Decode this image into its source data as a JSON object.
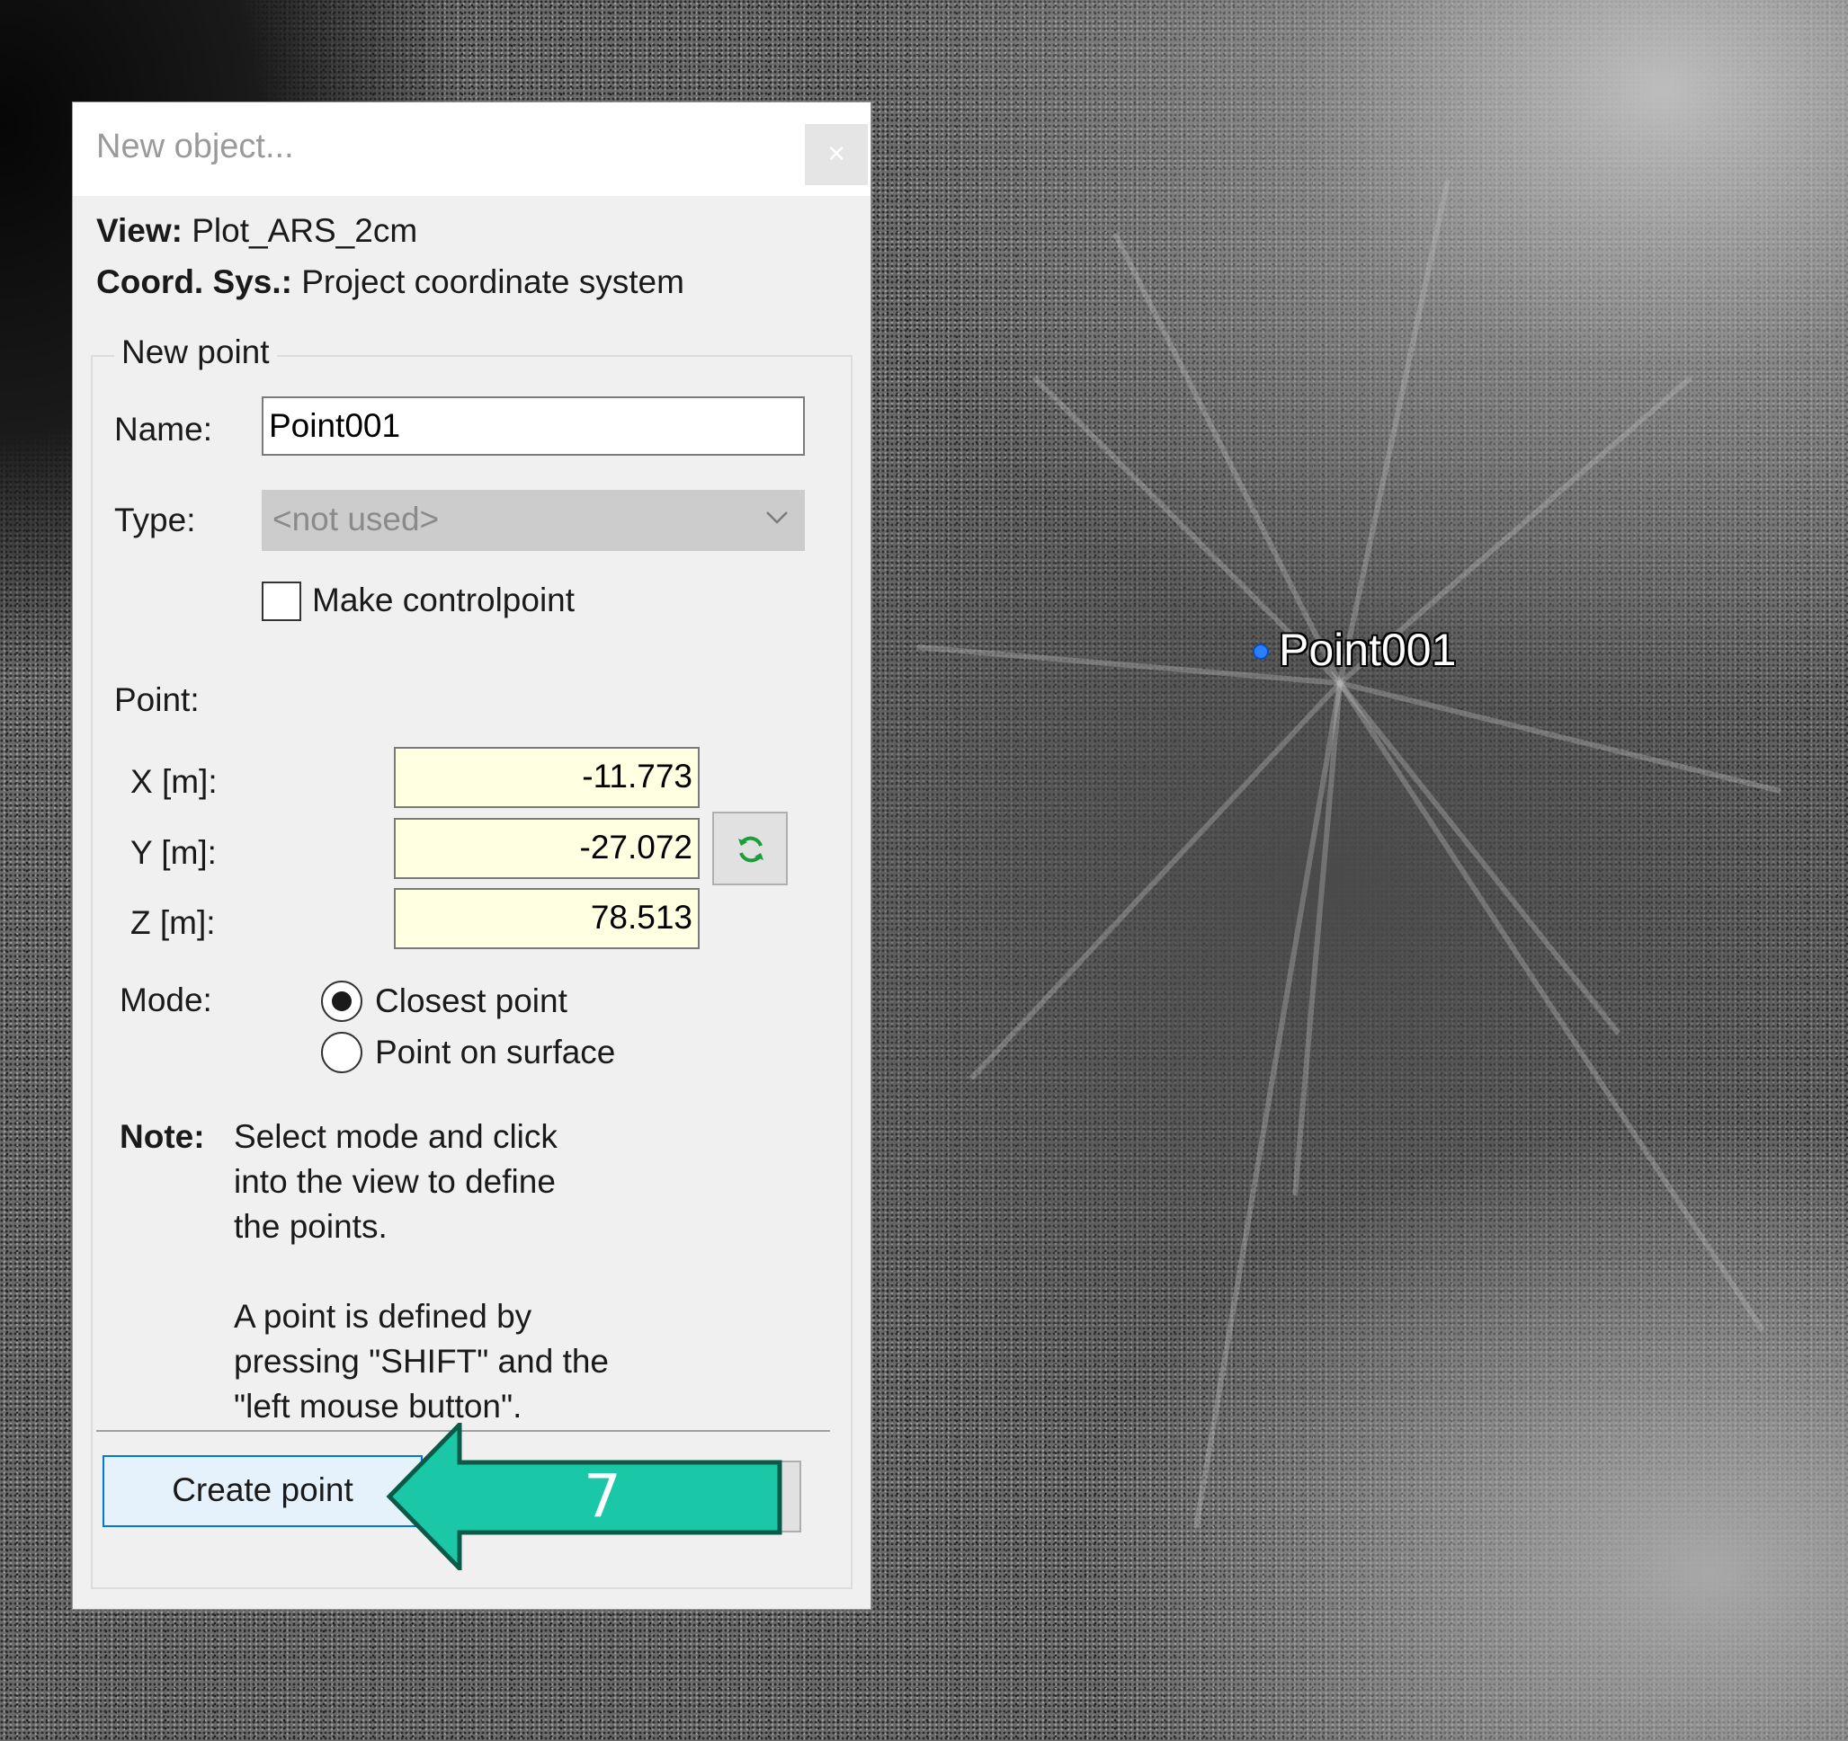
{
  "dialog": {
    "title": "New object...",
    "close_symbol": "×",
    "view_label": "View:",
    "view_value": "Plot_ARS_2cm",
    "coord_label": "Coord. Sys.:",
    "coord_value": "Project coordinate system",
    "group_title": "New point",
    "name_label": "Name:",
    "name_value": "Point001",
    "type_label": "Type:",
    "type_value": "<not used>",
    "make_controlpoint_label": "Make controlpoint",
    "make_controlpoint_checked": false,
    "point_label": "Point:",
    "x_label": "X [m]:",
    "x_value": "-11.773",
    "y_label": "Y [m]:",
    "y_value": "-27.072",
    "z_label": "Z [m]:",
    "z_value": "78.513",
    "refresh_icon": "refresh-icon",
    "mode_label": "Mode:",
    "mode_options": [
      "Closest point",
      "Point on surface"
    ],
    "mode_selected": "Closest point",
    "note_label": "Note:",
    "note_lines": [
      "Select mode and click",
      "into the view to define",
      "the points.",
      "",
      "A point is defined by",
      "pressing \"SHIFT\" and the",
      "\"left mouse button\"."
    ],
    "create_button": "Create point"
  },
  "annotation": {
    "step_number": "7",
    "arrow_color": "#1ac8a8"
  },
  "view": {
    "point_label": "Point001",
    "point_marker_color": "#2a7fff"
  }
}
